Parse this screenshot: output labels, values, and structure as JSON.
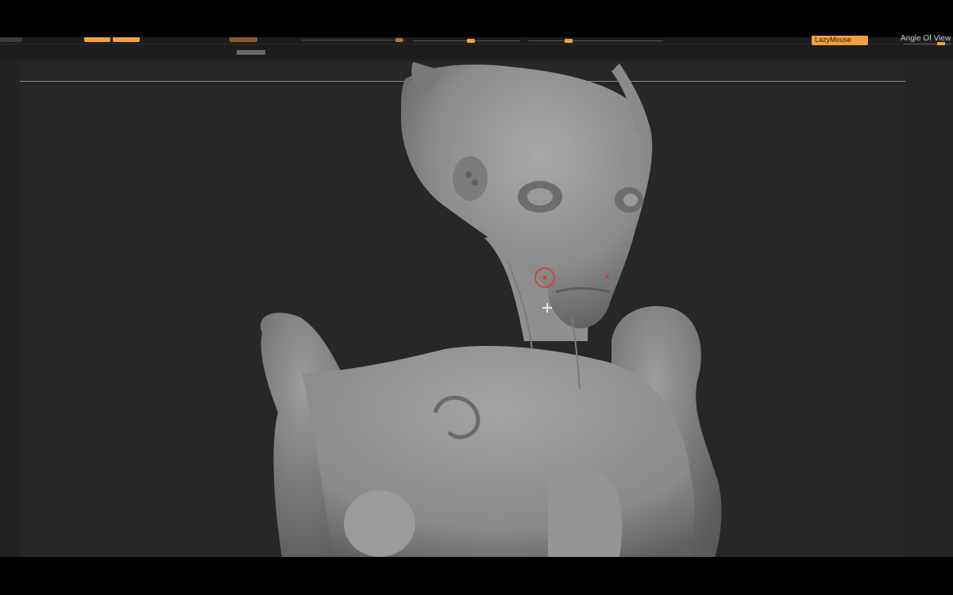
{
  "toolbar": {
    "lazymouse_label": "LazyMouse",
    "angle_of_view_label": "Angle Of View"
  },
  "canvas": {
    "background": "#272727",
    "accent": "#f0a042",
    "cursor_color": "#d23c3c"
  },
  "icons": {
    "brush_cursor": "brush-cursor-icon",
    "crosshair": "crosshair-icon"
  }
}
